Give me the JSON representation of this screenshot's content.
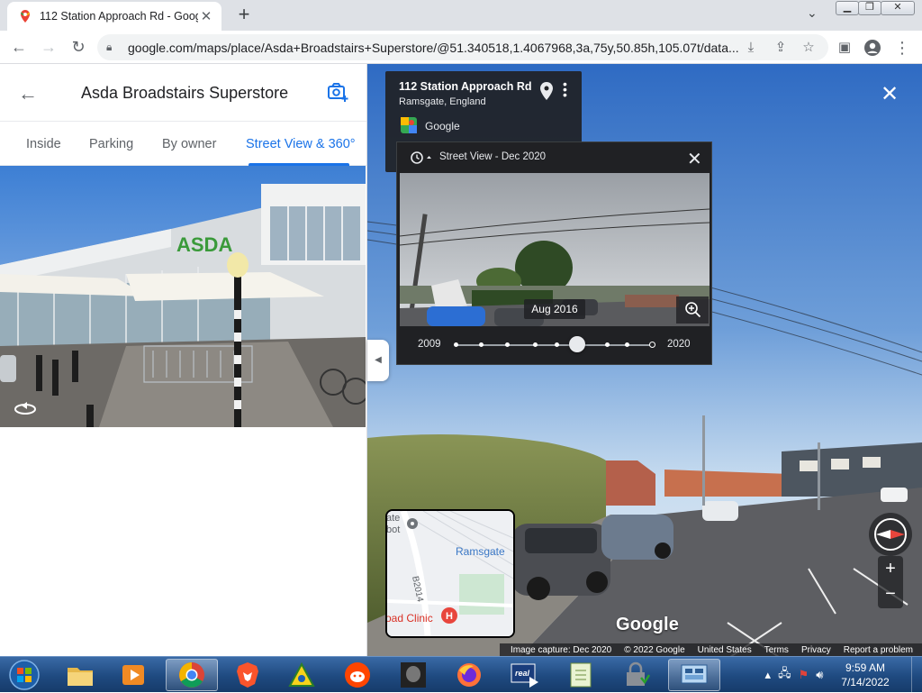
{
  "browser": {
    "tab_title": "112 Station Approach Rd - Goog",
    "tab_close": "✕",
    "new_tab": "+",
    "url": "google.com/maps/place/Asda+Broadstairs+Superstore/@51.340518,1.4067968,3a,75y,50.85h,105.07t/data..."
  },
  "left_panel": {
    "title": "Asda Broadstairs Superstore",
    "tabs": [
      {
        "label": "Inside"
      },
      {
        "label": "Parking"
      },
      {
        "label": "By owner"
      },
      {
        "label": "Street View & 360°"
      }
    ],
    "photo_sign": "ASDA"
  },
  "info_card": {
    "address": "112 Station Approach Rd",
    "city": "Ramsgate, England",
    "source": "Google"
  },
  "time_machine": {
    "header": "Street View - Dec 2020",
    "hover_date": "Aug 2016",
    "start_year": "2009",
    "end_year": "2020",
    "slider_position_fraction": 0.62
  },
  "minimap": {
    "label_town": "Ramsgate",
    "label_road": "B2014",
    "label_clinic": "oad Clinic",
    "label_partial": "ate\nbot"
  },
  "main_view": {
    "watermark": "Google",
    "footer": {
      "capture": "Image capture: Dec 2020",
      "copyright": "© 2022 Google",
      "region": "United States",
      "terms": "Terms",
      "privacy": "Privacy",
      "report": "Report a problem"
    }
  },
  "taskbar": {
    "time": "9:59 AM",
    "date": "7/14/2022"
  }
}
